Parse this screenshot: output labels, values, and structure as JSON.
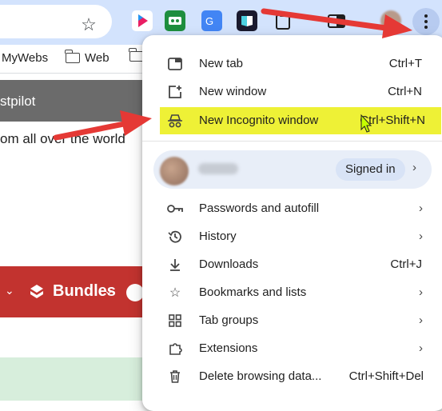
{
  "bookmarks": [
    {
      "label": "MyWebs",
      "kind": "partial"
    },
    {
      "label": "Web",
      "kind": "folder"
    }
  ],
  "page": {
    "header_fragment": "stpilot",
    "tagline_fragment": "om all over the world",
    "bundles_label": "Bundles"
  },
  "menu": {
    "new_tab": {
      "label": "New tab",
      "shortcut": "Ctrl+T"
    },
    "new_window": {
      "label": "New window",
      "shortcut": "Ctrl+N"
    },
    "incognito": {
      "label": "New Incognito window",
      "shortcut": "Ctrl+Shift+N"
    },
    "profile": {
      "status": "Signed in"
    },
    "passwords": {
      "label": "Passwords and autofill"
    },
    "history": {
      "label": "History"
    },
    "downloads": {
      "label": "Downloads",
      "shortcut": "Ctrl+J"
    },
    "bookmarks": {
      "label": "Bookmarks and lists"
    },
    "tab_groups": {
      "label": "Tab groups"
    },
    "extensions": {
      "label": "Extensions"
    },
    "delete_data": {
      "label": "Delete browsing data...",
      "shortcut": "Ctrl+Shift+Del"
    }
  },
  "colors": {
    "toolbar": "#d3e3fd",
    "highlight": "#eef136",
    "arrow": "#e53935",
    "red_bar": "#c2332f"
  },
  "icons": [
    "star-icon",
    "more-vert-icon",
    "folder-icon",
    "incognito-icon",
    "key-icon",
    "history-icon",
    "download-icon",
    "star-outline-icon",
    "tab-groups-icon",
    "puzzle-icon",
    "trash-icon"
  ]
}
